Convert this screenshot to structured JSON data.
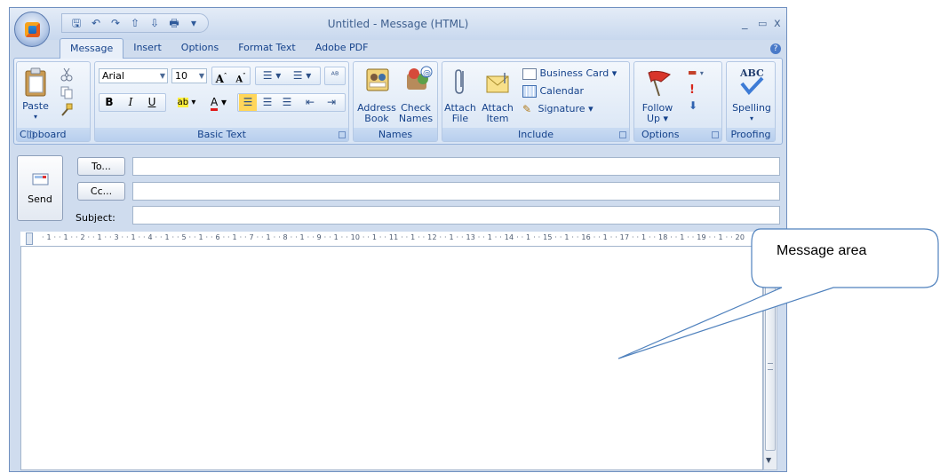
{
  "window": {
    "title": "Untitled - Message (HTML)",
    "controls": [
      "_",
      "▭",
      "x"
    ]
  },
  "qat": {
    "icons": [
      "save-icon",
      "undo-icon",
      "redo-icon",
      "up-arrow-icon",
      "down-arrow-icon",
      "print-icon",
      "customize-icon"
    ],
    "glyphs": [
      "🖫",
      "↶",
      "↷",
      "⇧",
      "⇩",
      "🖶",
      "▾"
    ]
  },
  "tabs": [
    "Message",
    "Insert",
    "Options",
    "Format Text",
    "Adobe PDF"
  ],
  "ribbon": {
    "clipboard": {
      "label": "Clipboard",
      "paste": "Paste"
    },
    "basic_text": {
      "label": "Basic Text",
      "font": "Arial",
      "size": "10"
    },
    "names": {
      "label": "Names",
      "address_book": [
        "Address",
        "Book"
      ],
      "check_names": [
        "Check",
        "Names"
      ]
    },
    "include": {
      "label": "Include",
      "attach_file": [
        "Attach",
        "File"
      ],
      "attach_item": [
        "Attach",
        "Item"
      ],
      "business_card": "Business Card ▾",
      "calendar": "Calendar",
      "signature": "Signature ▾"
    },
    "options": {
      "label": "Options",
      "follow_up": [
        "Follow",
        "Up ▾"
      ]
    },
    "proofing": {
      "label": "Proofing",
      "spelling": "Spelling"
    }
  },
  "header": {
    "send": "Send",
    "to": "To...",
    "cc": "Cc...",
    "subject": "Subject:",
    "to_value": "",
    "cc_value": "",
    "subject_value": ""
  },
  "ruler": "· 1 · · 1 · · 2 · · 1 · · 3 · · 1 · · 4 · · 1 · · 5 · · 1 · · 6 · · 1 · · 7 · · 1 · · 8 · · 1 · · 9 · · 1 · · 10 · · 1 · · 11 · · 1 · · 12 · · 1 · · 13 · · 1 · · 14 · · 1 · · 15 · · 1 · · 16 · · 1 · · 17 · · 1 · · 18 · · 1 · · 19 · · 1 · · 20",
  "callout": "Message area"
}
